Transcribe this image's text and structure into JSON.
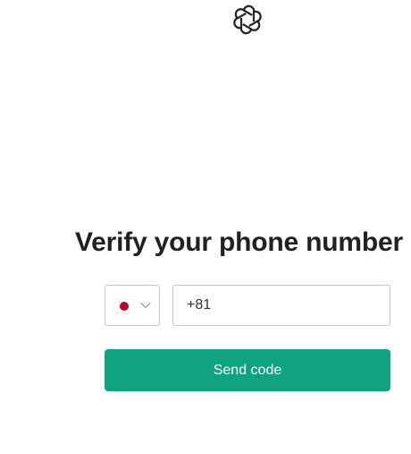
{
  "header": {
    "logo_icon": "openai-logo-icon"
  },
  "main": {
    "title": "Verify your phone number",
    "country": {
      "flag_icon": "japan-flag-icon",
      "chevron_icon": "chevron-down-icon"
    },
    "phone": {
      "value": "+81"
    },
    "send_button_label": "Send code"
  },
  "colors": {
    "accent": "#10a37f",
    "text": "#202123",
    "border": "#c2c8d0",
    "flag_red": "#bc002d"
  }
}
